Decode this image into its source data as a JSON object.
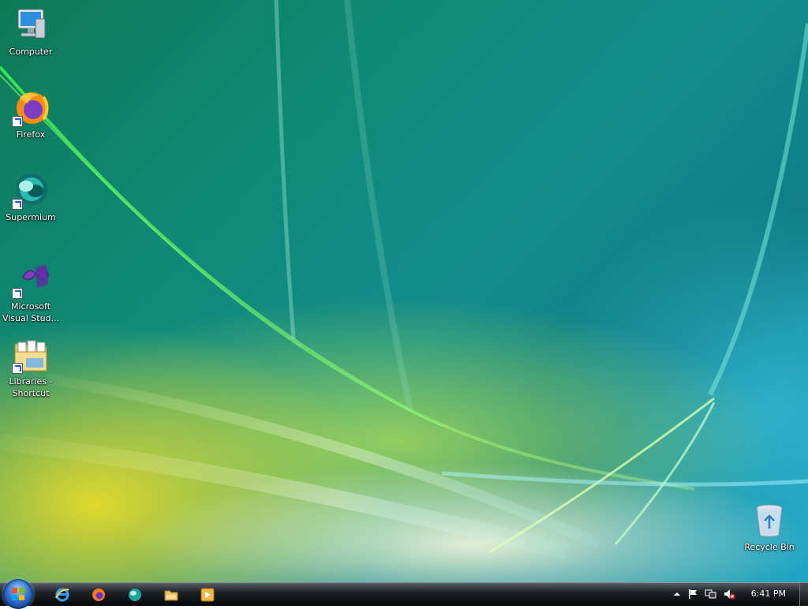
{
  "desktop": {
    "icons": [
      {
        "label": "Computer",
        "icon": "computer-icon"
      },
      {
        "label": "Firefox",
        "icon": "firefox-icon"
      },
      {
        "label": "Supermium",
        "icon": "supermium-icon"
      },
      {
        "label": "Microsoft\nVisual Stud...",
        "icon": "visual-studio-icon"
      },
      {
        "label": "Libraries -\nShortcut",
        "icon": "libraries-folder-icon"
      },
      {
        "label": "Recycle Bin",
        "icon": "recycle-bin-icon"
      }
    ]
  },
  "taskbar": {
    "start_icon": "windows-start-orb",
    "quick_launch": [
      "internet-explorer-icon",
      "firefox-icon",
      "supermium-icon",
      "file-explorer-icon",
      "media-player-icon"
    ],
    "tray": [
      "show-hidden-icons-chevron",
      "action-center-flag-icon",
      "network-icon",
      "volume-muted-icon"
    ],
    "clock": "6:41 PM"
  },
  "colors": {
    "taskbar": "#1e2226",
    "wallpaper_green": "#0f8a78",
    "wallpaper_yellow": "#e6dc2a"
  }
}
